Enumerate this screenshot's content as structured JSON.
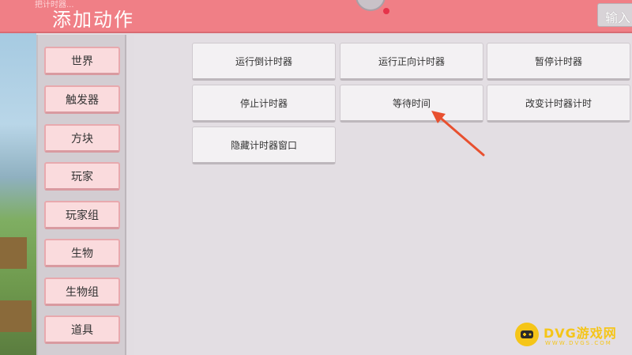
{
  "header": {
    "title": "添加动作",
    "faded_text": "把计时器...",
    "input_label": "输入"
  },
  "sidebar": {
    "items": [
      {
        "label": "世界"
      },
      {
        "label": "触发器"
      },
      {
        "label": "方块"
      },
      {
        "label": "玩家"
      },
      {
        "label": "玩家组"
      },
      {
        "label": "生物"
      },
      {
        "label": "生物组"
      },
      {
        "label": "道具"
      }
    ]
  },
  "actions": [
    {
      "label": "运行倒计时器"
    },
    {
      "label": "运行正向计时器"
    },
    {
      "label": "暂停计时器"
    },
    {
      "label": "停止计时器"
    },
    {
      "label": "等待时间"
    },
    {
      "label": "改变计时器计时"
    },
    {
      "label": "隐藏计时器窗口"
    }
  ],
  "watermark": {
    "text": "DVG游戏网",
    "sub": "WWW.DVGS.COM"
  },
  "colors": {
    "header": "#f07f86",
    "sidebar_button": "#fadbdd",
    "action_button": "#f3f1f3",
    "arrow": "#e8502f",
    "watermark": "#f5c518"
  }
}
